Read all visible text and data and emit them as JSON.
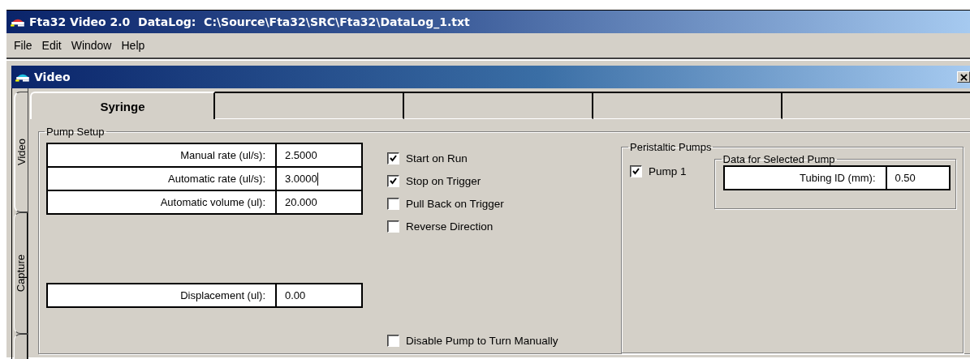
{
  "window": {
    "title": "Fta32 Video 2.0  DataLog:  C:\\Source\\Fta32\\SRC\\Fta32\\DataLog_1.txt"
  },
  "menu": [
    {
      "label": "File"
    },
    {
      "label": "Edit"
    },
    {
      "label": "Window"
    },
    {
      "label": "Help"
    }
  ],
  "child_window": {
    "title": "Video"
  },
  "side_tabs": [
    {
      "label": "Video",
      "selected": true
    },
    {
      "label": "Capture",
      "selected": false
    },
    {
      "selected": false
    }
  ],
  "tabs": [
    {
      "label": "Syringe",
      "selected": true
    },
    {
      "selected": false
    },
    {
      "selected": false
    },
    {
      "selected": false
    },
    {
      "selected": false
    }
  ],
  "pump_setup": {
    "title": "Pump Setup",
    "fields": [
      {
        "label": "Manual rate (ul/s):",
        "value": "2.5000",
        "focused": false
      },
      {
        "label": "Automatic rate (ul/s):",
        "value": "3.0000",
        "focused": true
      },
      {
        "label": "Automatic volume (ul):",
        "value": "20.000",
        "focused": false
      }
    ],
    "displacement": {
      "label": "Displacement (ul):",
      "value": "0.00"
    },
    "options": [
      {
        "label": "Start on Run",
        "checked": true
      },
      {
        "label": "Stop on Trigger",
        "checked": true
      },
      {
        "label": "Pull Back on Trigger",
        "checked": false
      },
      {
        "label": "Reverse Direction",
        "checked": false
      }
    ],
    "disable_option": {
      "label": "Disable Pump to Turn Manually",
      "checked": false
    }
  },
  "peristaltic": {
    "title": "Peristaltic Pumps",
    "pumps": [
      {
        "label": "Pump 1",
        "checked": true
      }
    ],
    "selected_pump": {
      "title": "Data for Selected Pump",
      "field": {
        "label": "Tubing ID (mm):",
        "value": "0.50"
      }
    }
  }
}
